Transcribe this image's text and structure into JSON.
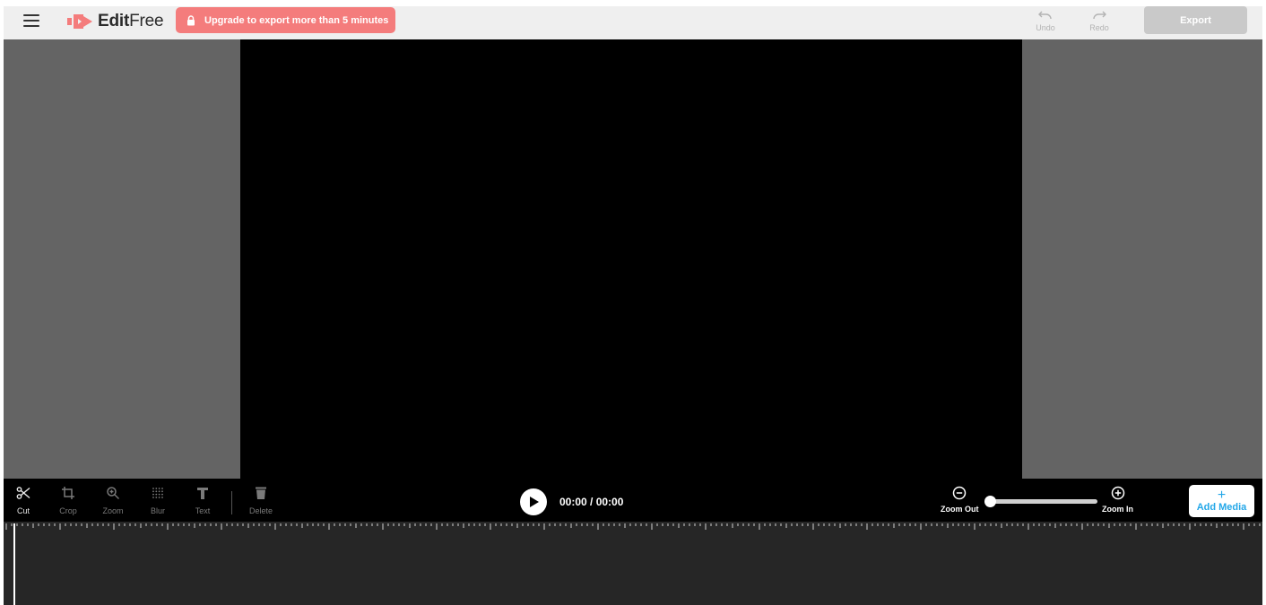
{
  "header": {
    "logo_bold": "Edit",
    "logo_light": "Free",
    "upgrade_label": "Upgrade to export more than 5 minutes",
    "undo_label": "Undo",
    "redo_label": "Redo",
    "export_label": "Export",
    "brand_color": "#f47c7c"
  },
  "toolbar": {
    "tools": [
      {
        "label": "Cut",
        "icon": "scissors-icon",
        "enabled": true
      },
      {
        "label": "Crop",
        "icon": "crop-icon",
        "enabled": false
      },
      {
        "label": "Zoom",
        "icon": "magnifier-icon",
        "enabled": false
      },
      {
        "label": "Blur",
        "icon": "blur-icon",
        "enabled": false
      },
      {
        "label": "Text",
        "icon": "text-icon",
        "enabled": false
      },
      {
        "label": "Delete",
        "icon": "trash-icon",
        "enabled": false
      }
    ],
    "timecode": "00:00 / 00:00",
    "zoom_out_label": "Zoom Out",
    "zoom_in_label": "Zoom In",
    "zoom_level": 0,
    "add_media_plus": "+",
    "add_media_label": "Add Media",
    "accent_color": "#23a7e8"
  }
}
